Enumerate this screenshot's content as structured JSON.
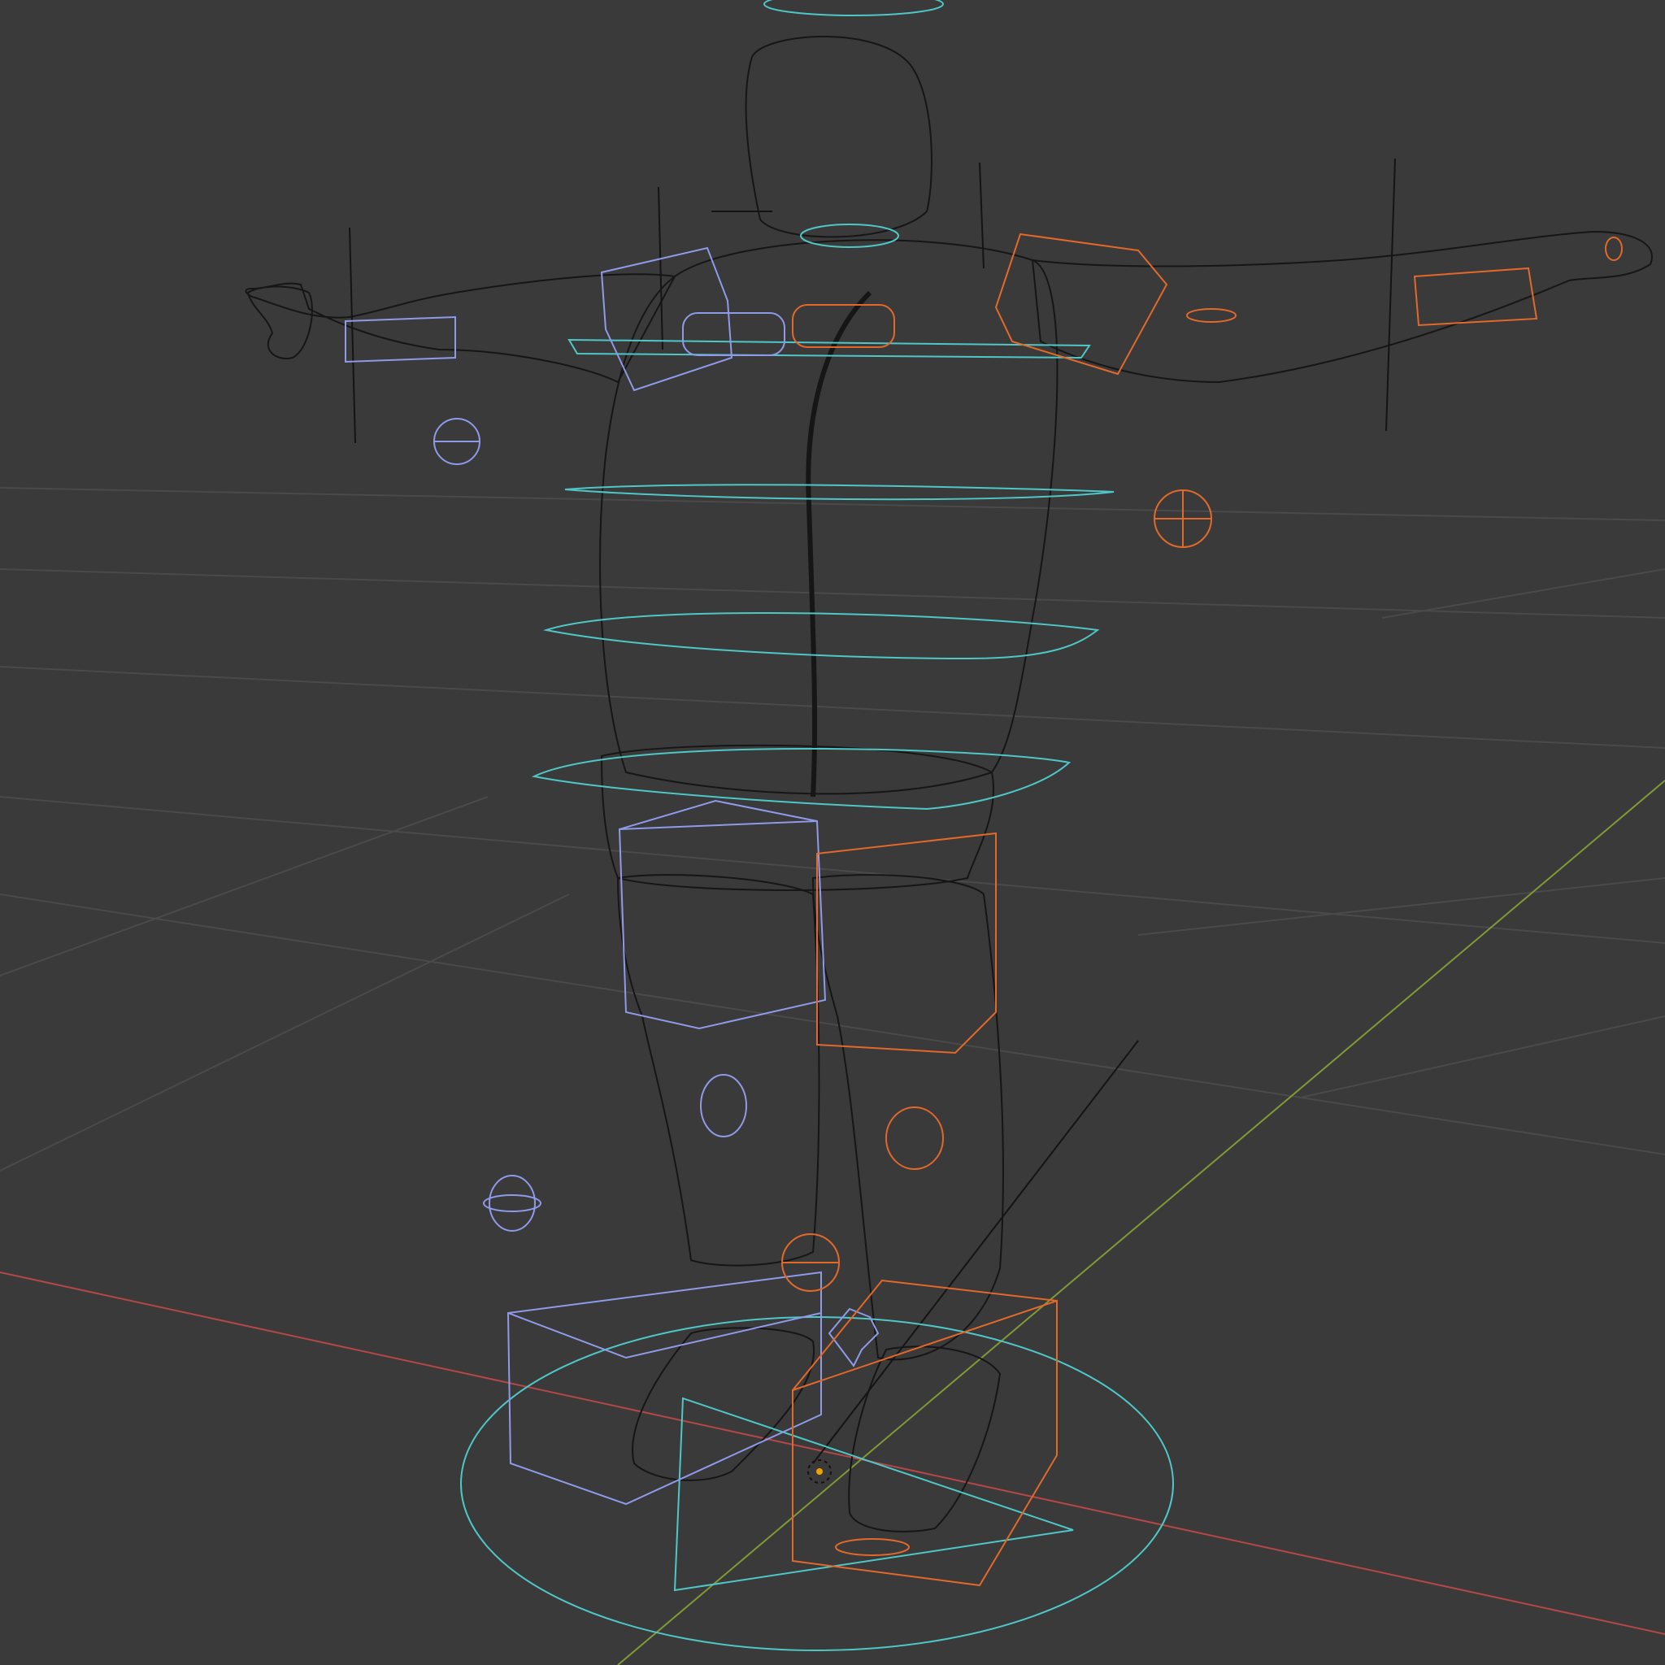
{
  "viewport": {
    "background": "#3a3a3a",
    "grid_color": "#4a4a4a",
    "x_axis_color": "#b44747",
    "y_axis_color": "#7f9a36",
    "mesh_wire_color": "#161616",
    "controls": {
      "center_color": "#4fc7c7",
      "left_color": "#8f9ae8",
      "right_color": "#e2692a"
    },
    "objects": [
      {
        "name": "character-mesh",
        "icon": "wireframe-mesh"
      },
      {
        "name": "rig-controls",
        "icon": "bone-controls"
      },
      {
        "name": "origin-point",
        "icon": "light-point"
      }
    ]
  }
}
